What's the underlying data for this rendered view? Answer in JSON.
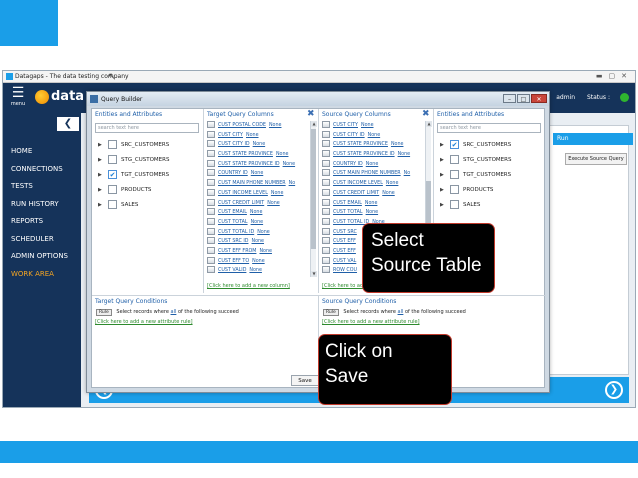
{
  "app": {
    "title": "Datagaps - The data testing company",
    "menu_label": "menu",
    "logo_text": "data",
    "user": "admin",
    "status_label": "Status :",
    "partial_right_text": "p"
  },
  "sidebar": {
    "items": [
      {
        "label": "HOME"
      },
      {
        "label": "CONNECTIONS"
      },
      {
        "label": "TESTS"
      },
      {
        "label": "RUN HISTORY"
      },
      {
        "label": "REPORTS"
      },
      {
        "label": "SCHEDULER"
      },
      {
        "label": "ADMIN OPTIONS"
      },
      {
        "label": "WORK AREA"
      }
    ]
  },
  "main": {
    "run_header": "Run",
    "execute_button": "Execute Source Query"
  },
  "dialog": {
    "title": "Query Builder",
    "left_entities": {
      "header": "Entities and Attributes",
      "search_placeholder": "search text here",
      "items": [
        {
          "label": "SRC_CUSTOMERS",
          "checked": false
        },
        {
          "label": "STG_CUSTOMERS",
          "checked": false
        },
        {
          "label": "TGT_CUSTOMERS",
          "checked": true
        },
        {
          "label": "PRODUCTS",
          "checked": false
        },
        {
          "label": "SALES",
          "checked": false
        }
      ]
    },
    "target_columns": {
      "header": "Target Query Columns",
      "add_link": "[Click here to add a new column]",
      "rows": [
        {
          "name": "CUST POSTAL CODE",
          "agg": "None"
        },
        {
          "name": "CUST CITY",
          "agg": "None"
        },
        {
          "name": "CUST CITY ID",
          "agg": "None"
        },
        {
          "name": "CUST STATE PROVINCE",
          "agg": "None"
        },
        {
          "name": "CUST STATE PROVINCE ID",
          "agg": "None"
        },
        {
          "name": "COUNTRY ID",
          "agg": "None"
        },
        {
          "name": "CUST MAIN PHONE NUMBER",
          "agg": "No"
        },
        {
          "name": "CUST INCOME LEVEL",
          "agg": "None"
        },
        {
          "name": "CUST CREDIT LIMIT",
          "agg": "None"
        },
        {
          "name": "CUST EMAIL",
          "agg": "None"
        },
        {
          "name": "CUST TOTAL",
          "agg": "None"
        },
        {
          "name": "CUST TOTAL ID",
          "agg": "None"
        },
        {
          "name": "CUST SRC ID",
          "agg": "None"
        },
        {
          "name": "CUST EFF FROM",
          "agg": "None"
        },
        {
          "name": "CUST EFF TO",
          "agg": "None"
        },
        {
          "name": "CUST VALID",
          "agg": "None"
        }
      ]
    },
    "source_columns": {
      "header": "Source Query Columns",
      "add_link": "[Click here to add a new column]",
      "rows": [
        {
          "name": "CUST CITY",
          "agg": "None"
        },
        {
          "name": "CUST CITY ID",
          "agg": "None"
        },
        {
          "name": "CUST STATE PROVINCE",
          "agg": "None"
        },
        {
          "name": "CUST STATE PROVINCE ID",
          "agg": "None"
        },
        {
          "name": "COUNTRY ID",
          "agg": "None"
        },
        {
          "name": "CUST MAIN PHONE NUMBER",
          "agg": "No"
        },
        {
          "name": "CUST INCOME LEVEL",
          "agg": "None"
        },
        {
          "name": "CUST CREDIT LIMIT",
          "agg": "None"
        },
        {
          "name": "CUST EMAIL",
          "agg": "None"
        },
        {
          "name": "CUST TOTAL",
          "agg": "None"
        },
        {
          "name": "CUST TOTAL ID",
          "agg": "None"
        },
        {
          "name": "CUST SRC",
          "agg": ""
        },
        {
          "name": "CUST EFF",
          "agg": ""
        },
        {
          "name": "CUST EFF",
          "agg": ""
        },
        {
          "name": "CUST VAL",
          "agg": ""
        },
        {
          "name": "ROW COU",
          "agg": ""
        }
      ]
    },
    "right_entities": {
      "header": "Entities and Attributes",
      "search_placeholder": "search text here",
      "items": [
        {
          "label": "SRC_CUSTOMERS",
          "checked": true
        },
        {
          "label": "STG_CUSTOMERS",
          "checked": false
        },
        {
          "label": "TGT_CUSTOMERS",
          "checked": false
        },
        {
          "label": "PRODUCTS",
          "checked": false
        },
        {
          "label": "SALES",
          "checked": false
        }
      ]
    },
    "target_conditions": {
      "header": "Target Query Conditions",
      "rule_button": "Rule",
      "text_before": "Select records where",
      "quantifier": "all",
      "text_after": "of the following succeed",
      "add_link": "[Click here to add a new attribute rule]"
    },
    "source_conditions": {
      "header": "Source Query Conditions",
      "rule_button": "Rule",
      "text_before": "Select records where",
      "quantifier": "all",
      "text_after": "of the following succeed",
      "add_link": "[Click here to add a new attribute rule]"
    },
    "save_button": "Save"
  },
  "callouts": {
    "select_source_line1": "Select",
    "select_source_line2": "Source Table",
    "click_save_line1": "Click on",
    "click_save_line2": "Save"
  },
  "colors": {
    "accent": "#1a9ee8",
    "navy": "#15335a",
    "nav_active": "#f5a623",
    "status_ok": "#2fb52f"
  }
}
